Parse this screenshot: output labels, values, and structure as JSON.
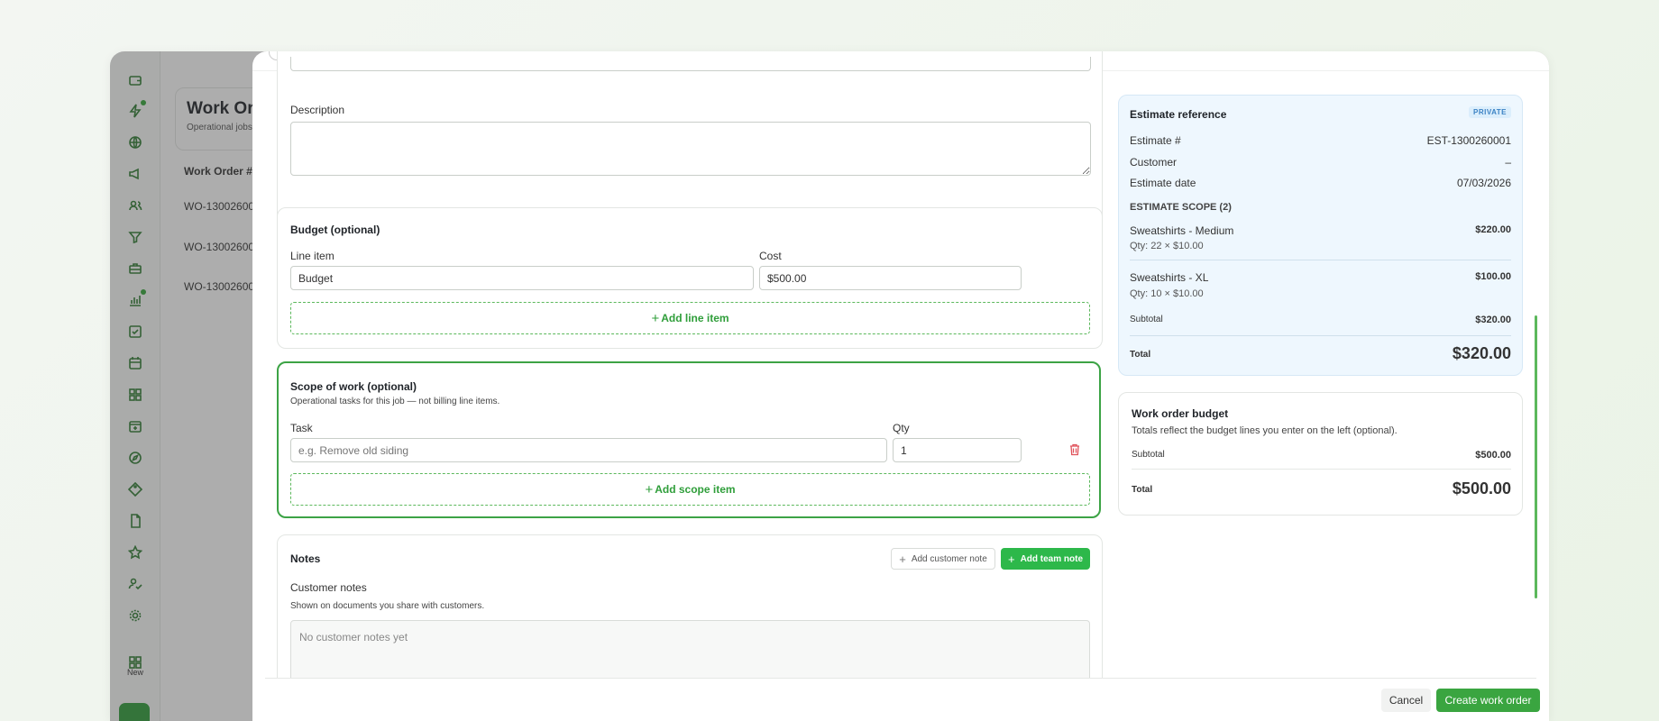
{
  "background_page": {
    "title": "Work Ord",
    "subtitle": "Operational jobs",
    "table_header": "Work Order #",
    "rows": [
      "WO-13002600",
      "WO-13002600",
      "WO-13002600"
    ],
    "sidebar_new_label": "New"
  },
  "form": {
    "description": {
      "label": "Description",
      "value": ""
    },
    "budget": {
      "title": "Budget (optional)",
      "line_item_label": "Line item",
      "cost_label": "Cost",
      "line_item_value": "Budget",
      "cost_value": "$500.00",
      "add_button": "Add line item"
    },
    "scope": {
      "title": "Scope of work (optional)",
      "subtitle": "Operational tasks for this job — not billing line items.",
      "task_label": "Task",
      "qty_label": "Qty",
      "task_placeholder": "e.g. Remove old siding",
      "qty_value": "1",
      "add_button": "Add scope item"
    },
    "notes": {
      "title": "Notes",
      "add_customer_note": "Add customer note",
      "add_team_note": "Add team note",
      "customer_notes_label": "Customer notes",
      "customer_notes_help": "Shown on documents you share with customers.",
      "customer_notes_empty": "No customer notes yet"
    }
  },
  "estimate_reference": {
    "title": "Estimate reference",
    "badge": "PRIVATE",
    "estimate_num_label": "Estimate #",
    "estimate_num_value": "EST-1300260001",
    "customer_label": "Customer",
    "customer_value": "–",
    "date_label": "Estimate date",
    "date_value": "07/03/2026",
    "scope_heading": "ESTIMATE SCOPE (2)",
    "items": [
      {
        "name": "Sweatshirts - Medium",
        "qty": "Qty: 22 × $10.00",
        "amount": "$220.00"
      },
      {
        "name": "Sweatshirts - XL",
        "qty": "Qty: 10 × $10.00",
        "amount": "$100.00"
      }
    ],
    "subtotal_label": "Subtotal",
    "subtotal_value": "$320.00",
    "total_label": "Total",
    "total_value": "$320.00"
  },
  "work_order_budget": {
    "title": "Work order budget",
    "subtitle": "Totals reflect the budget lines you enter on the left (optional).",
    "subtotal_label": "Subtotal",
    "subtotal_value": "$500.00",
    "total_label": "Total",
    "total_value": "$500.00"
  },
  "footer": {
    "cancel": "Cancel",
    "create": "Create work order"
  },
  "colors": {
    "accent": "#2f9e3a",
    "estimate_bg": "#eef7fe",
    "badge_text": "#3b82c4",
    "delete_icon": "#e0525a"
  }
}
